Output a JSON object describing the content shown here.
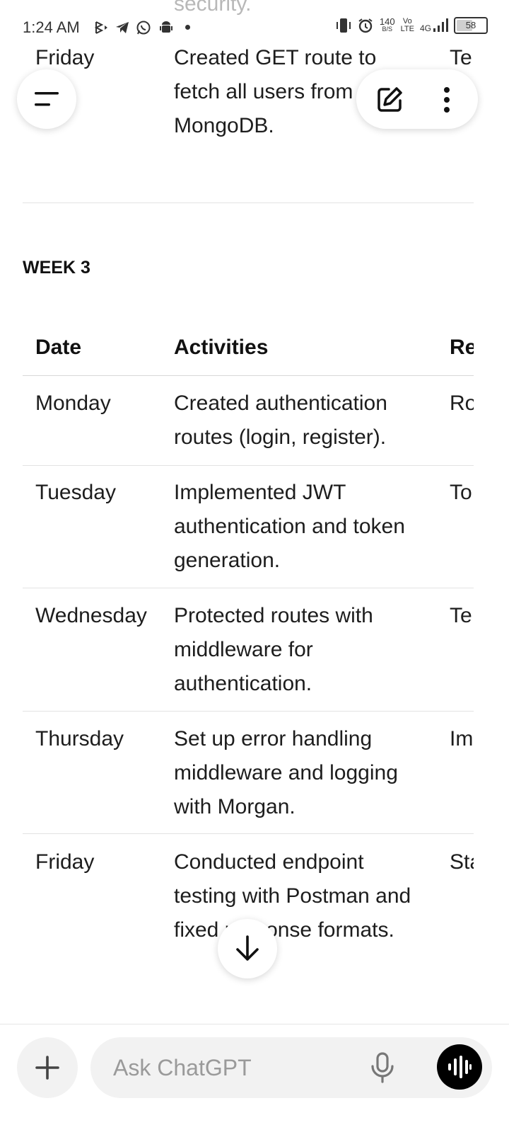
{
  "status_bar": {
    "time": "1:24 AM",
    "net_speed_value": "140",
    "net_speed_unit": "B/S",
    "volte_top": "Vo",
    "volte_bottom": "LTE",
    "network": "4G",
    "battery": "58"
  },
  "previous": {
    "overflow_text": "security.",
    "last_row": {
      "day": "Friday",
      "activity": [
        "Created GET route to",
        "fetch all users from",
        "MongoDB."
      ],
      "remark_partial": "Te"
    }
  },
  "week3": {
    "heading": "WEEK 3",
    "columns": [
      "Date",
      "Activities",
      "Re"
    ],
    "rows": [
      {
        "day": "Monday",
        "lines": [
          "Created authentication",
          "routes (login, register)."
        ],
        "remark": "Ro"
      },
      {
        "day": "Tuesday",
        "lines": [
          "Implemented JWT",
          "authentication and token",
          "generation."
        ],
        "remark": "To"
      },
      {
        "day": "Wednesday",
        "lines": [
          "Protected routes with",
          "middleware for",
          "authentication."
        ],
        "remark": "Te"
      },
      {
        "day": "Thursday",
        "lines": [
          "Set up error handling",
          "middleware and logging",
          "with Morgan."
        ],
        "remark": "Im"
      },
      {
        "day": "Friday",
        "lines": [
          "Conducted endpoint",
          "testing with Postman and",
          "fixed response formats."
        ],
        "remark": "Sta"
      }
    ]
  },
  "composer": {
    "placeholder": "Ask ChatGPT"
  },
  "icons": {
    "menu": "menu-icon",
    "new_chat": "edit-icon",
    "more": "more-vertical-icon",
    "scroll_down": "arrow-down-icon",
    "plus": "plus-icon",
    "mic": "mic-icon",
    "voice": "voice-wave-icon"
  }
}
